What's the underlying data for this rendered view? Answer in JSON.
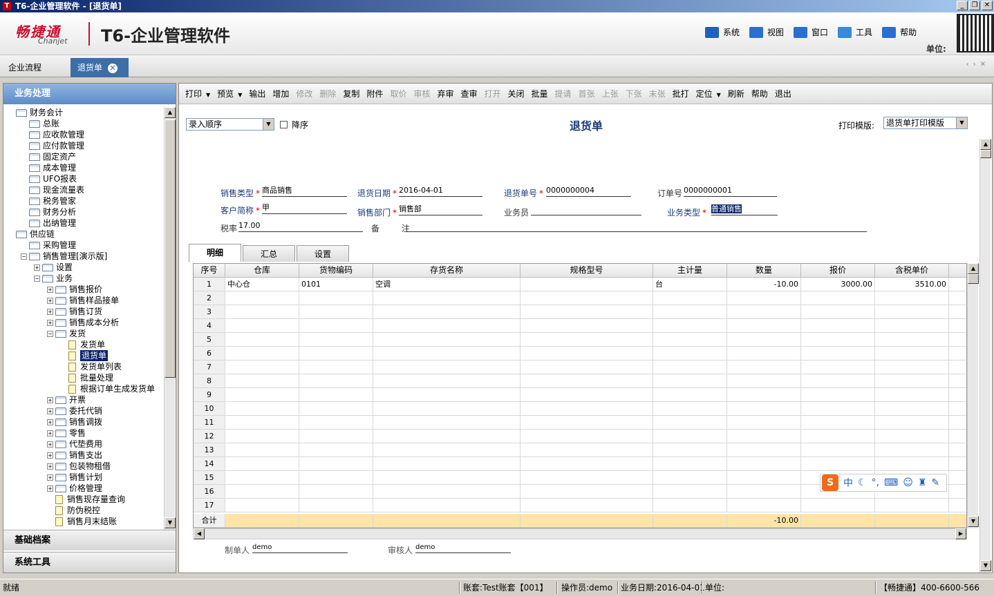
{
  "window": {
    "title": "T6-企业管理软件 - [退货单]",
    "logo": "T"
  },
  "header": {
    "brand_cn": "畅捷通",
    "brand_en": "Chanjet",
    "product": "T6-企业管理软件",
    "menu": [
      {
        "label": "系统",
        "icon": "monitor-icon",
        "color": "#1f5fbf"
      },
      {
        "label": "视图",
        "icon": "windows-icon",
        "color": "#2a6fd0"
      },
      {
        "label": "窗口",
        "icon": "window-icon",
        "color": "#2a6fd0"
      },
      {
        "label": "工具",
        "icon": "gear-icon",
        "color": "#3a8ad8"
      },
      {
        "label": "帮助",
        "icon": "help-icon",
        "color": "#2a6fd0"
      }
    ],
    "unit_label": "单位:"
  },
  "tabs": {
    "flow": "企业流程",
    "active": "退货单"
  },
  "left_panel": {
    "title": "业务处理",
    "sections": [
      "基础档案",
      "系统工具"
    ],
    "tree": [
      {
        "label": "财务会计",
        "level": 0,
        "type": "folder",
        "toggle": ""
      },
      {
        "label": "总账",
        "level": 1,
        "type": "folder",
        "toggle": ""
      },
      {
        "label": "应收款管理",
        "level": 1,
        "type": "folder",
        "toggle": ""
      },
      {
        "label": "应付款管理",
        "level": 1,
        "type": "folder",
        "toggle": ""
      },
      {
        "label": "固定资产",
        "level": 1,
        "type": "folder",
        "toggle": ""
      },
      {
        "label": "成本管理",
        "level": 1,
        "type": "folder",
        "toggle": ""
      },
      {
        "label": "UFO报表",
        "level": 1,
        "type": "folder",
        "toggle": ""
      },
      {
        "label": "现金流量表",
        "level": 1,
        "type": "folder",
        "toggle": ""
      },
      {
        "label": "税务管家",
        "level": 1,
        "type": "folder",
        "toggle": ""
      },
      {
        "label": "财务分析",
        "level": 1,
        "type": "folder",
        "toggle": ""
      },
      {
        "label": "出纳管理",
        "level": 1,
        "type": "folder",
        "toggle": ""
      },
      {
        "label": "供应链",
        "level": 0,
        "type": "folder",
        "toggle": ""
      },
      {
        "label": "采购管理",
        "level": 1,
        "type": "folder",
        "toggle": ""
      },
      {
        "label": "销售管理[演示版]",
        "level": 1,
        "type": "folder",
        "toggle": "−"
      },
      {
        "label": "设置",
        "level": 2,
        "type": "folder",
        "toggle": "+"
      },
      {
        "label": "业务",
        "level": 2,
        "type": "folder",
        "toggle": "−"
      },
      {
        "label": "销售报价",
        "level": 3,
        "type": "folder",
        "toggle": "+"
      },
      {
        "label": "销售样品接单",
        "level": 3,
        "type": "folder",
        "toggle": "+"
      },
      {
        "label": "销售订货",
        "level": 3,
        "type": "folder",
        "toggle": "+"
      },
      {
        "label": "销售成本分析",
        "level": 3,
        "type": "folder",
        "toggle": "+"
      },
      {
        "label": "发货",
        "level": 3,
        "type": "folder",
        "toggle": "−"
      },
      {
        "label": "发货单",
        "level": 4,
        "type": "doc",
        "toggle": ""
      },
      {
        "label": "退货单",
        "level": 4,
        "type": "doc",
        "toggle": "",
        "selected": true
      },
      {
        "label": "发货单列表",
        "level": 4,
        "type": "doc",
        "toggle": ""
      },
      {
        "label": "批量处理",
        "level": 4,
        "type": "doc",
        "toggle": ""
      },
      {
        "label": "根据订单生成发货单",
        "level": 4,
        "type": "doc",
        "toggle": ""
      },
      {
        "label": "开票",
        "level": 3,
        "type": "folder",
        "toggle": "+"
      },
      {
        "label": "委托代销",
        "level": 3,
        "type": "folder",
        "toggle": "+"
      },
      {
        "label": "销售调拨",
        "level": 3,
        "type": "folder",
        "toggle": "+"
      },
      {
        "label": "零售",
        "level": 3,
        "type": "folder",
        "toggle": "+"
      },
      {
        "label": "代垫费用",
        "level": 3,
        "type": "folder",
        "toggle": "+"
      },
      {
        "label": "销售支出",
        "level": 3,
        "type": "folder",
        "toggle": "+"
      },
      {
        "label": "包装物租借",
        "level": 3,
        "type": "folder",
        "toggle": "+"
      },
      {
        "label": "销售计划",
        "level": 3,
        "type": "folder",
        "toggle": "+"
      },
      {
        "label": "价格管理",
        "level": 3,
        "type": "folder",
        "toggle": "+"
      },
      {
        "label": "销售现存量查询",
        "level": 3,
        "type": "doc",
        "toggle": ""
      },
      {
        "label": "防伪税控",
        "level": 3,
        "type": "doc",
        "toggle": ""
      },
      {
        "label": "销售月末结账",
        "level": 3,
        "type": "doc",
        "toggle": ""
      }
    ]
  },
  "toolbar": [
    {
      "label": "打印",
      "dd": true,
      "enabled": true
    },
    {
      "label": "预览",
      "dd": true,
      "enabled": true
    },
    {
      "label": "输出",
      "enabled": true
    },
    {
      "label": "增加",
      "enabled": true
    },
    {
      "label": "修改",
      "enabled": false
    },
    {
      "label": "删除",
      "enabled": false
    },
    {
      "label": "复制",
      "enabled": true
    },
    {
      "label": "附件",
      "enabled": true
    },
    {
      "label": "取价",
      "enabled": false
    },
    {
      "label": "审核",
      "enabled": false
    },
    {
      "label": "弃审",
      "enabled": true
    },
    {
      "label": "查审",
      "enabled": true
    },
    {
      "label": "打开",
      "enabled": false
    },
    {
      "label": "关闭",
      "enabled": true
    },
    {
      "label": "批量",
      "enabled": true
    },
    {
      "label": "提请",
      "enabled": false
    },
    {
      "label": "首张",
      "enabled": false
    },
    {
      "label": "上张",
      "enabled": false
    },
    {
      "label": "下张",
      "enabled": false
    },
    {
      "label": "末张",
      "enabled": false
    },
    {
      "label": "批打",
      "enabled": true
    },
    {
      "label": "定位",
      "dd": true,
      "enabled": true
    },
    {
      "label": "刷新",
      "enabled": true
    },
    {
      "label": "帮助",
      "enabled": true
    },
    {
      "label": "退出",
      "enabled": true
    }
  ],
  "form": {
    "sort_combo": "录入顺序",
    "desc_checkbox": "降序",
    "title": "退货单",
    "print_template_label": "打印模版:",
    "print_template_value": "退货单打印模版",
    "fields": {
      "sale_type": {
        "label": "销售类型",
        "value": "商品销售",
        "required": true
      },
      "return_date": {
        "label": "退货日期",
        "value": "2016-04-01",
        "required": true
      },
      "return_no": {
        "label": "退货单号",
        "value": "0000000004",
        "required": true
      },
      "order_no": {
        "label": "订单号",
        "value": "0000000001"
      },
      "customer": {
        "label": "客户简称",
        "value": "甲",
        "required": true
      },
      "department": {
        "label": "销售部门",
        "value": "销售部",
        "required": true
      },
      "salesman": {
        "label": "业务员",
        "value": ""
      },
      "biz_type": {
        "label": "业务类型",
        "value": "普通销售",
        "required": true
      },
      "tax_rate": {
        "label": "税率",
        "value": "17.00"
      },
      "remark": {
        "label": "备 注",
        "value": ""
      }
    },
    "subtabs": [
      "明细",
      "汇总",
      "设置"
    ],
    "grid": {
      "columns": [
        "序号",
        "仓库",
        "货物编码",
        "存货名称",
        "规格型号",
        "主计量",
        "数量",
        "报价",
        "含税单价"
      ],
      "rows": [
        [
          "1",
          "中心仓",
          "0101",
          "空调",
          "",
          "台",
          "-10.00",
          "3000.00",
          "3510.00"
        ],
        [
          "2",
          "",
          "",
          "",
          "",
          "",
          "",
          "",
          ""
        ],
        [
          "3",
          "",
          "",
          "",
          "",
          "",
          "",
          "",
          ""
        ],
        [
          "4",
          "",
          "",
          "",
          "",
          "",
          "",
          "",
          ""
        ],
        [
          "5",
          "",
          "",
          "",
          "",
          "",
          "",
          "",
          ""
        ],
        [
          "6",
          "",
          "",
          "",
          "",
          "",
          "",
          "",
          ""
        ],
        [
          "7",
          "",
          "",
          "",
          "",
          "",
          "",
          "",
          ""
        ],
        [
          "8",
          "",
          "",
          "",
          "",
          "",
          "",
          "",
          ""
        ],
        [
          "9",
          "",
          "",
          "",
          "",
          "",
          "",
          "",
          ""
        ],
        [
          "10",
          "",
          "",
          "",
          "",
          "",
          "",
          "",
          ""
        ],
        [
          "11",
          "",
          "",
          "",
          "",
          "",
          "",
          "",
          ""
        ],
        [
          "12",
          "",
          "",
          "",
          "",
          "",
          "",
          "",
          ""
        ],
        [
          "13",
          "",
          "",
          "",
          "",
          "",
          "",
          "",
          ""
        ],
        [
          "14",
          "",
          "",
          "",
          "",
          "",
          "",
          "",
          ""
        ],
        [
          "15",
          "",
          "",
          "",
          "",
          "",
          "",
          "",
          ""
        ],
        [
          "16",
          "",
          "",
          "",
          "",
          "",
          "",
          "",
          ""
        ],
        [
          "17",
          "",
          "",
          "",
          "",
          "",
          "",
          "",
          ""
        ]
      ],
      "total": [
        "合计",
        "",
        "",
        "",
        "",
        "",
        "-10.00",
        "",
        ""
      ]
    },
    "maker": {
      "label": "制单人",
      "value": "demo"
    },
    "auditor": {
      "label": "审核人",
      "value": "demo"
    }
  },
  "ime": {
    "logo": "S",
    "mode": "中"
  },
  "status": {
    "ready": "就绪",
    "account": "账套:Test账套【001】",
    "operator": "操作员:demo",
    "biz_date": "业务日期:2016-04-01",
    "unit": "单位:",
    "hotline": "【畅捷通】400-6600-566"
  },
  "colors": {
    "accent": "#3c6ea8",
    "label_blue": "#1c3c78",
    "required_red": "#cc0000",
    "total_row": "#ffe4a8"
  }
}
